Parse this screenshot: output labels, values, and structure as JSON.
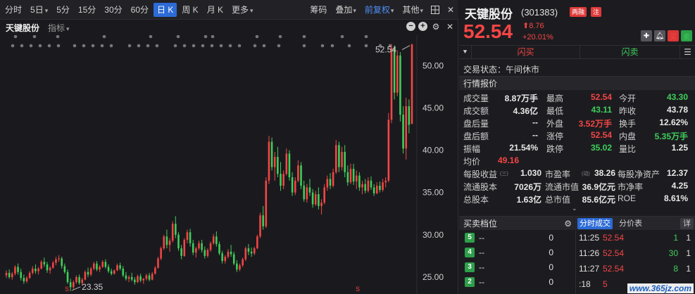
{
  "toolbar": {
    "periods": [
      "分时",
      "5日",
      "5分",
      "15分",
      "30分",
      "60分",
      "日 K",
      "周 K",
      "月 K",
      "更多"
    ],
    "active_period": "日 K",
    "tools": {
      "chip": "筹码",
      "overlay": "叠加",
      "adjust": "前复权",
      "other": "其他"
    },
    "colors": {
      "active_tab": "#2d6bd6",
      "adjust_text": "#4f8ff7"
    }
  },
  "chart_header": {
    "stock_name": "天键股份",
    "indicator": "指标"
  },
  "chart_data": {
    "type": "candlestick",
    "y_ticks": [
      "50.00",
      "45.00",
      "40.00",
      "35.00",
      "30.00",
      "25.00"
    ],
    "ylim": [
      23.0,
      53.6
    ],
    "high_label": "52.54",
    "low_label": "23.35",
    "marker_s": "S",
    "up_color": "#f54545",
    "down_color": "#3ecf5a",
    "candles": [
      [
        25.2,
        25.8,
        24.9,
        25.5
      ],
      [
        25.5,
        25.9,
        24.8,
        25.0
      ],
      [
        25.0,
        25.6,
        24.7,
        25.4
      ],
      [
        25.4,
        26.4,
        25.2,
        26.2
      ],
      [
        26.2,
        26.6,
        25.3,
        25.6
      ],
      [
        25.6,
        26.0,
        24.6,
        24.9
      ],
      [
        24.9,
        25.3,
        24.2,
        24.5
      ],
      [
        24.5,
        25.1,
        24.3,
        24.9
      ],
      [
        24.9,
        25.7,
        24.8,
        25.5
      ],
      [
        25.5,
        26.3,
        25.3,
        26.0
      ],
      [
        26.0,
        26.5,
        25.4,
        25.7
      ],
      [
        25.7,
        26.2,
        25.3,
        26.0
      ],
      [
        26.0,
        27.0,
        25.9,
        26.8
      ],
      [
        26.8,
        27.3,
        26.2,
        26.5
      ],
      [
        26.5,
        26.8,
        25.5,
        25.8
      ],
      [
        25.8,
        26.3,
        25.4,
        26.1
      ],
      [
        26.1,
        26.9,
        26.0,
        26.7
      ],
      [
        26.7,
        27.4,
        26.4,
        27.1
      ],
      [
        27.1,
        27.6,
        26.8,
        27.2
      ],
      [
        27.2,
        27.4,
        26.0,
        26.3
      ],
      [
        26.3,
        26.6,
        25.4,
        25.6
      ],
      [
        25.6,
        25.9,
        24.2,
        24.4
      ],
      [
        24.4,
        24.8,
        23.35,
        23.8
      ],
      [
        23.8,
        24.6,
        23.6,
        24.4
      ],
      [
        24.4,
        25.2,
        24.2,
        25.0
      ],
      [
        25.0,
        25.3,
        24.1,
        24.3
      ],
      [
        24.3,
        24.9,
        24.0,
        24.7
      ],
      [
        24.7,
        25.8,
        24.6,
        25.6
      ],
      [
        25.6,
        26.1,
        25.0,
        25.3
      ],
      [
        25.3,
        26.2,
        25.1,
        26.0
      ],
      [
        26.0,
        26.8,
        25.8,
        26.6
      ],
      [
        26.6,
        26.9,
        25.7,
        25.9
      ],
      [
        25.9,
        26.4,
        25.6,
        26.2
      ],
      [
        26.2,
        27.0,
        26.1,
        26.8
      ],
      [
        26.8,
        27.1,
        26.0,
        26.2
      ],
      [
        26.2,
        26.5,
        25.5,
        25.7
      ],
      [
        25.7,
        26.0,
        25.2,
        25.4
      ],
      [
        25.4,
        25.9,
        25.3,
        25.8
      ],
      [
        25.8,
        26.6,
        25.7,
        26.4
      ],
      [
        26.4,
        26.7,
        25.8,
        26.0
      ],
      [
        26.0,
        26.3,
        25.0,
        25.2
      ],
      [
        25.2,
        25.6,
        24.6,
        24.8
      ],
      [
        24.8,
        25.2,
        24.4,
        25.0
      ],
      [
        25.0,
        25.5,
        24.5,
        24.7
      ],
      [
        24.7,
        25.0,
        24.1,
        24.4
      ],
      [
        24.4,
        25.3,
        24.3,
        25.1
      ],
      [
        25.1,
        25.4,
        24.4,
        24.6
      ],
      [
        24.6,
        24.9,
        24.2,
        24.8
      ],
      [
        24.8,
        25.4,
        24.6,
        25.2
      ],
      [
        25.2,
        25.5,
        24.5,
        24.7
      ],
      [
        24.7,
        25.6,
        24.6,
        25.4
      ],
      [
        25.4,
        26.3,
        25.3,
        26.1
      ],
      [
        26.1,
        27.4,
        26.0,
        27.2
      ],
      [
        27.2,
        28.6,
        27.0,
        28.4
      ],
      [
        28.4,
        30.0,
        28.2,
        29.8
      ],
      [
        29.8,
        30.6,
        28.4,
        28.8
      ],
      [
        28.8,
        29.6,
        28.0,
        29.3
      ],
      [
        29.3,
        31.6,
        29.1,
        31.3
      ],
      [
        31.3,
        32.2,
        29.6,
        30.0
      ],
      [
        30.0,
        30.3,
        28.1,
        28.4
      ],
      [
        28.4,
        28.8,
        27.1,
        27.5
      ],
      [
        27.5,
        29.6,
        27.4,
        29.4
      ],
      [
        29.4,
        30.6,
        29.0,
        30.3
      ],
      [
        30.3,
        30.7,
        28.6,
        29.0
      ],
      [
        29.0,
        29.4,
        27.6,
        27.9
      ],
      [
        27.9,
        28.6,
        27.3,
        28.4
      ],
      [
        28.4,
        29.3,
        28.2,
        29.0
      ],
      [
        29.0,
        29.4,
        27.9,
        28.2
      ],
      [
        28.2,
        28.6,
        27.2,
        27.5
      ],
      [
        27.5,
        28.4,
        27.3,
        28.2
      ],
      [
        28.2,
        29.2,
        28.0,
        29.0
      ],
      [
        29.0,
        30.1,
        28.8,
        29.8
      ],
      [
        29.8,
        30.4,
        28.6,
        28.9
      ],
      [
        28.9,
        29.2,
        27.6,
        27.8
      ],
      [
        27.8,
        28.1,
        26.6,
        26.9
      ],
      [
        26.9,
        27.6,
        26.6,
        27.4
      ],
      [
        27.4,
        28.3,
        27.2,
        28.0
      ],
      [
        28.0,
        28.8,
        27.4,
        27.7
      ],
      [
        27.7,
        28.0,
        26.4,
        26.6
      ],
      [
        26.6,
        27.0,
        25.6,
        25.9
      ],
      [
        25.9,
        26.6,
        25.7,
        26.4
      ],
      [
        26.4,
        27.3,
        26.2,
        27.1
      ],
      [
        27.1,
        28.6,
        26.9,
        28.4
      ],
      [
        28.4,
        28.9,
        27.6,
        28.0
      ],
      [
        28.0,
        28.5,
        27.4,
        27.8
      ],
      [
        27.8,
        28.6,
        27.6,
        28.4
      ],
      [
        28.4,
        30.0,
        28.3,
        29.8
      ],
      [
        29.8,
        32.6,
        29.6,
        32.3
      ],
      [
        32.3,
        33.4,
        30.6,
        31.0
      ],
      [
        31.0,
        36.8,
        30.8,
        36.4
      ],
      [
        36.4,
        41.7,
        36.0,
        41.0
      ],
      [
        41.0,
        41.5,
        37.6,
        38.0
      ],
      [
        38.0,
        39.8,
        36.4,
        39.2
      ],
      [
        39.2,
        40.4,
        36.8,
        37.2
      ],
      [
        37.2,
        38.6,
        35.2,
        35.8
      ],
      [
        35.8,
        37.6,
        35.4,
        37.2
      ],
      [
        37.2,
        40.2,
        37.0,
        39.6
      ],
      [
        39.6,
        40.0,
        36.4,
        36.8
      ],
      [
        36.8,
        37.4,
        34.6,
        35.0
      ],
      [
        35.0,
        36.8,
        34.7,
        36.4
      ],
      [
        36.4,
        38.8,
        36.2,
        38.2
      ],
      [
        38.2,
        38.6,
        35.4,
        35.8
      ],
      [
        35.8,
        36.4,
        33.9,
        34.2
      ],
      [
        34.2,
        36.0,
        33.8,
        35.6
      ],
      [
        35.6,
        36.6,
        34.6,
        35.0
      ],
      [
        35.0,
        35.4,
        33.2,
        33.6
      ],
      [
        33.6,
        35.2,
        33.4,
        34.8
      ],
      [
        34.8,
        35.6,
        33.0,
        33.4
      ],
      [
        33.4,
        34.2,
        32.4,
        33.8
      ],
      [
        33.8,
        36.0,
        33.6,
        35.6
      ],
      [
        35.6,
        37.0,
        35.2,
        36.6
      ],
      [
        36.6,
        37.3,
        35.4,
        35.8
      ],
      [
        35.8,
        37.8,
        35.6,
        37.4
      ],
      [
        37.4,
        41.2,
        37.2,
        40.6
      ],
      [
        40.6,
        41.0,
        37.4,
        38.0
      ],
      [
        38.0,
        40.4,
        37.6,
        39.8
      ],
      [
        39.8,
        40.6,
        36.8,
        37.4
      ],
      [
        37.4,
        38.2,
        35.8,
        36.2
      ],
      [
        36.2,
        38.4,
        36.0,
        37.8
      ],
      [
        37.8,
        38.4,
        35.9,
        36.3
      ],
      [
        36.3,
        37.6,
        35.4,
        37.0
      ],
      [
        37.0,
        37.4,
        35.2,
        35.6
      ],
      [
        35.6,
        36.4,
        34.8,
        36.0
      ],
      [
        36.0,
        36.6,
        34.9,
        35.2
      ],
      [
        35.2,
        36.8,
        35.0,
        36.4
      ],
      [
        36.4,
        36.9,
        35.3,
        35.6
      ],
      [
        35.6,
        36.0,
        34.6,
        34.9
      ],
      [
        34.9,
        36.2,
        34.8,
        35.8
      ],
      [
        35.8,
        36.3,
        35.0,
        35.3
      ],
      [
        35.3,
        36.6,
        35.1,
        36.2
      ],
      [
        36.2,
        36.8,
        35.6,
        36.4
      ],
      [
        36.4,
        44.4,
        36.2,
        43.6
      ],
      [
        43.6,
        52.54,
        43.2,
        52.1
      ],
      [
        52.1,
        52.4,
        46.0,
        46.8
      ],
      [
        46.8,
        51.8,
        46.4,
        51.2
      ],
      [
        51.2,
        51.6,
        43.4,
        44.2
      ],
      [
        44.2,
        45.2,
        39.6,
        40.2
      ],
      [
        40.2,
        46.2,
        38.9,
        45.2
      ],
      [
        45.2,
        46.0,
        42.0,
        43.0
      ],
      [
        43.11,
        52.54,
        43.11,
        52.54
      ]
    ]
  },
  "quote": {
    "name": "天键股份",
    "code": "(301383)",
    "badges": [
      "两融",
      "注"
    ],
    "price": "52.54",
    "change": "8.76",
    "change_pct": "+20.01%",
    "buttons": {
      "buy": "买",
      "sell": "卖"
    },
    "flash_buy": "闪买",
    "flash_sell": "闪卖",
    "trade_state": "交易状态：午间休市",
    "section_title": "行情报价",
    "rows": [
      [
        "成交量",
        "8.87万手",
        "最高",
        "52.54",
        "今开",
        "43.30"
      ],
      [
        "成交额",
        "4.36亿",
        "最低",
        "43.11",
        "昨收",
        "43.78"
      ],
      [
        "盘后量",
        "--",
        "外盘",
        "3.52万手",
        "换手",
        "12.62%"
      ],
      [
        "盘后额",
        "--",
        "涨停",
        "52.54",
        "内盘",
        "5.35万手"
      ],
      [
        "振幅",
        "21.54%",
        "跌停",
        "35.02",
        "量比",
        "1.25"
      ],
      [
        "均价",
        "49.16",
        "",
        "",
        "",
        ""
      ]
    ],
    "fund_rows": [
      [
        "每股收益",
        "(三)",
        "1.030",
        "市盈率",
        "(动)",
        "38.26",
        "每股净资产",
        "12.37"
      ],
      [
        "流通股本",
        "",
        "7026万",
        "流通市值",
        "",
        "36.9亿元",
        "市净率",
        "4.25"
      ],
      [
        "总股本",
        "",
        "1.63亿",
        "总市值",
        "",
        "85.6亿元",
        "ROE",
        "8.61%"
      ]
    ]
  },
  "orderbook": {
    "title": "买卖档位",
    "rows": [
      [
        "5",
        "--",
        "0"
      ],
      [
        "4",
        "--",
        "0"
      ],
      [
        "3",
        "--",
        "0"
      ],
      [
        "2",
        "--",
        "0"
      ]
    ]
  },
  "ticks": {
    "tabs": [
      "分时成交",
      "分价表",
      "详"
    ],
    "rows": [
      [
        "11:25",
        "52.54",
        "1",
        "1"
      ],
      [
        "11:26",
        "52.54",
        "30",
        "1"
      ],
      [
        "11:27",
        "52.54",
        "8",
        "1"
      ],
      [
        ":18",
        "5",
        "",
        ""
      ]
    ]
  },
  "watermark": "www.365jz.com"
}
